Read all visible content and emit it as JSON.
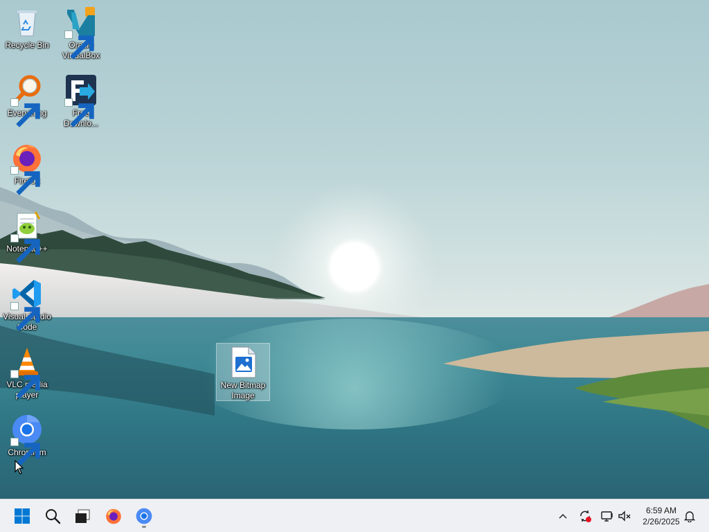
{
  "desktop": {
    "icons": [
      {
        "label": "Recycle Bin",
        "icon": "recycle-bin-icon"
      },
      {
        "label": "Oracle VirtualBox",
        "icon": "virtualbox-icon"
      },
      {
        "label": "Everything",
        "icon": "everything-search-icon"
      },
      {
        "label": "Free Downlo...",
        "icon": "free-download-manager-icon"
      },
      {
        "label": "Firefox",
        "icon": "firefox-icon"
      },
      {
        "label": "Notepad++",
        "icon": "notepad-plus-plus-icon"
      },
      {
        "label": "Visual Studio Code",
        "icon": "vscode-icon"
      },
      {
        "label": "VLC media player",
        "icon": "vlc-icon"
      },
      {
        "label": "Chromium",
        "icon": "chromium-icon"
      },
      {
        "label": "New Bitmap Image",
        "icon": "bitmap-image-icon",
        "selected": true
      }
    ]
  },
  "taskbar": {
    "pinned": [
      {
        "name": "start",
        "icon": "windows-start-icon"
      },
      {
        "name": "search",
        "icon": "search-icon"
      },
      {
        "name": "terminal",
        "icon": "terminal-icon"
      },
      {
        "name": "firefox",
        "icon": "firefox-icon"
      },
      {
        "name": "chromium",
        "icon": "chromium-icon",
        "active": true
      }
    ],
    "tray": [
      {
        "name": "show-hidden",
        "icon": "chevron-up-icon"
      },
      {
        "name": "update",
        "icon": "sync-alert-icon"
      },
      {
        "name": "network",
        "icon": "network-icon"
      },
      {
        "name": "volume",
        "icon": "volume-muted-icon"
      },
      {
        "name": "notifications",
        "icon": "bell-icon"
      }
    ],
    "clock": {
      "time": "6:59 AM",
      "date": "2/26/2025"
    }
  },
  "colors": {
    "accent_blue": "#0078d4",
    "taskbar_bg": "#eef0f3"
  }
}
